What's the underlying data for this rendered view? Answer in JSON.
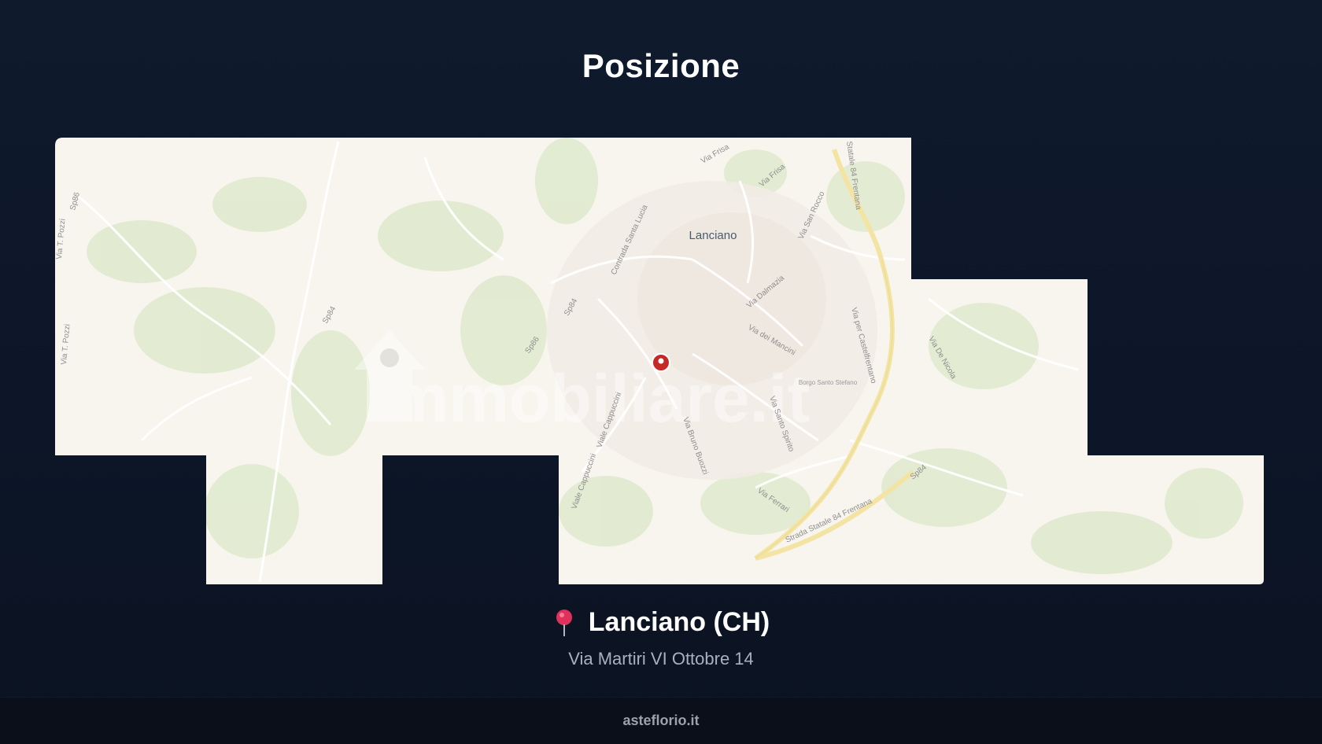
{
  "page": {
    "title": "Posizione"
  },
  "map": {
    "marker_icon": "location-marker-icon",
    "watermark": "immobiliare.it",
    "place_label": "Lanciano",
    "street_labels": [
      "Via Frisa",
      "Via Frisa",
      "Statale 84 Frentana",
      "Via San Rocco",
      "Contrada Santa Lucia",
      "Via Dalmazia",
      "Via dei Mancini",
      "Via per Castelfrentano",
      "Via Santo Spirito",
      "Viale Cappuccini",
      "Via Bruno Buozzi",
      "Strada Statale 84 Frentana",
      "Via T. Pozzi",
      "Via T. Pozzi",
      "Via Ferrari",
      "Viale Cappuccini",
      "Via De Nicola",
      "Sp86",
      "Sp84",
      "Sp84",
      "Sp86",
      "Sp84"
    ],
    "district_label": "Borgo Santo Stefano",
    "colors": {
      "land": "#f8f5ee",
      "green": "#d9e8c9",
      "road_major": "#f3e6a8",
      "marker": "#c62828"
    }
  },
  "address": {
    "pin_icon": "map-pin-icon",
    "city": "Lanciano (CH)",
    "street": "Via Martiri VI Ottobre 14"
  },
  "footer": {
    "site": "asteflorio.it"
  }
}
